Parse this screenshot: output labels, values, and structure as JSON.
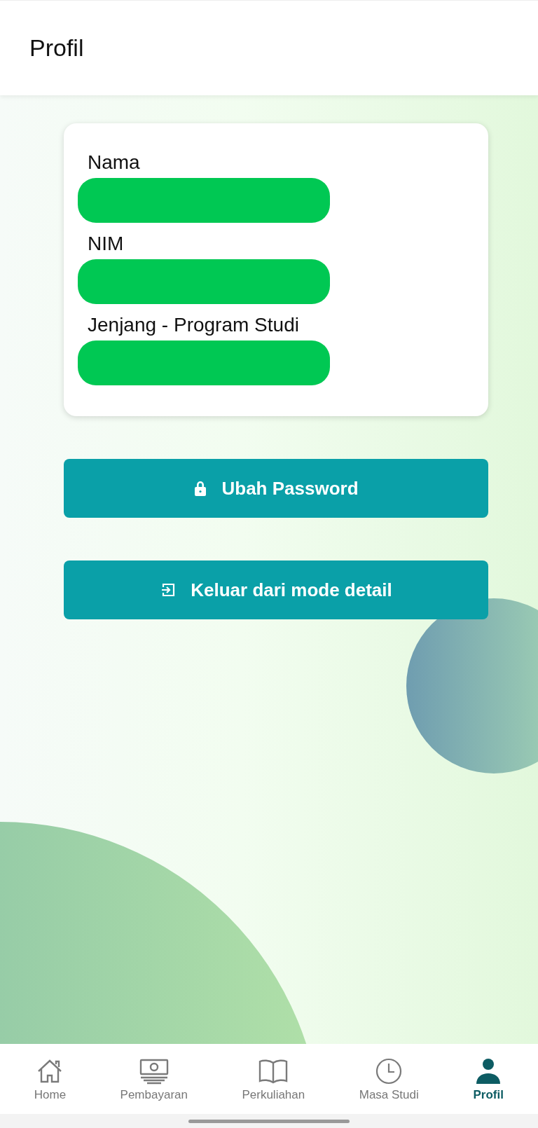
{
  "header": {
    "title": "Profil"
  },
  "profile_card": {
    "fields": [
      {
        "label": "Nama",
        "redacted": true
      },
      {
        "label": "NIM",
        "redacted": true
      },
      {
        "label": "Jenjang - Program Studi",
        "redacted": true
      }
    ]
  },
  "buttons": [
    {
      "kind": "lock",
      "label": "Ubah Password"
    },
    {
      "kind": "exit",
      "label": "Keluar dari mode detail"
    }
  ],
  "bottom_nav": [
    {
      "kind": "home",
      "label": "Home",
      "selected": false
    },
    {
      "kind": "money",
      "label": "Pembayaran",
      "selected": false
    },
    {
      "kind": "book",
      "label": "Perkuliahan",
      "selected": false
    },
    {
      "kind": "clock",
      "label": "Masa Studi",
      "selected": false
    },
    {
      "kind": "person",
      "label": "Profil",
      "selected": true
    }
  ]
}
